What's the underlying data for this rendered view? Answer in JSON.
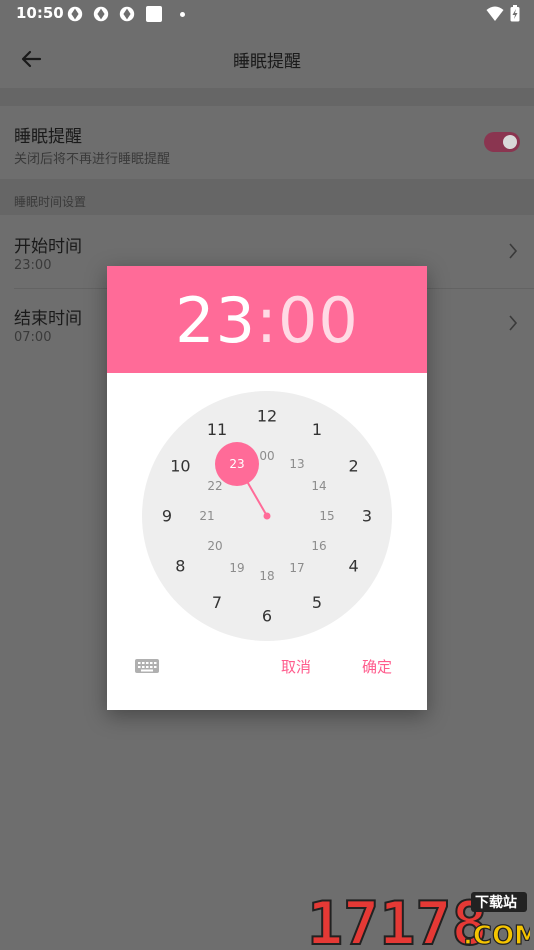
{
  "status": {
    "time": "10:50"
  },
  "appbar": {
    "title": "睡眠提醒"
  },
  "settings": {
    "sleep_reminder": {
      "title": "睡眠提醒",
      "subtitle": "关闭后将不再进行睡眠提醒",
      "enabled": true
    },
    "section_label": "睡眠时间设置",
    "start": {
      "title": "开始时间",
      "value": "23:00"
    },
    "end": {
      "title": "结束时间",
      "value": "07:00"
    }
  },
  "dialog": {
    "hour": "23",
    "colon": ":",
    "minute": "00",
    "selected_hour": "23",
    "outer_hours": [
      "12",
      "1",
      "2",
      "3",
      "4",
      "5",
      "6",
      "7",
      "8",
      "9",
      "10",
      "11"
    ],
    "inner_hours": [
      "00",
      "13",
      "14",
      "15",
      "16",
      "17",
      "18",
      "19",
      "20",
      "21",
      "22",
      "23"
    ],
    "cancel_label": "取消",
    "ok_label": "确定"
  },
  "watermark": {
    "logo_text": "17178",
    "badge_text": "下载站",
    "domain_text": ".COM"
  },
  "colors": {
    "accent": "#ff6b98",
    "accent_text": "#ff5c8d",
    "clock_face": "#eeeeee",
    "scrim": "#6e6e6e"
  }
}
